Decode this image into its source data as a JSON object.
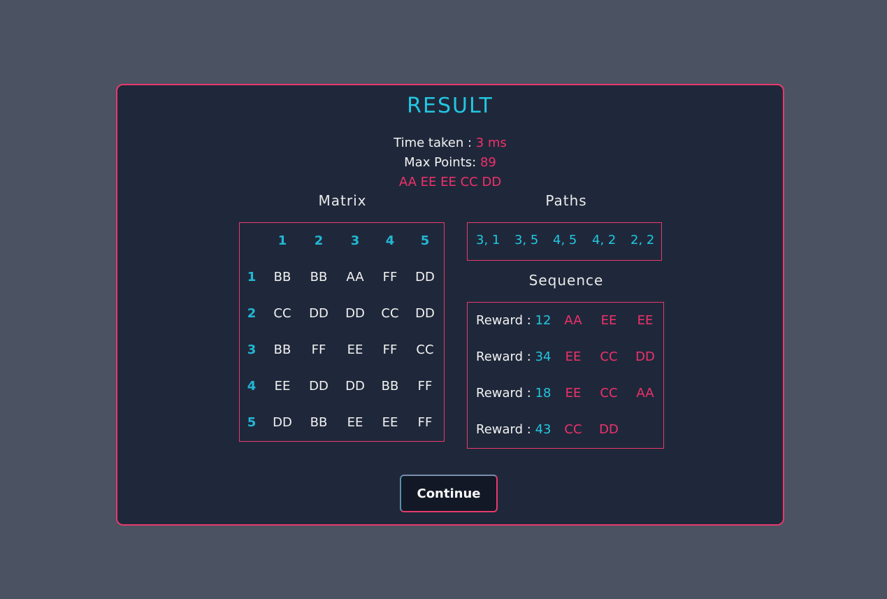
{
  "title": "RESULT",
  "time_taken_label": "Time taken :",
  "time_taken_value": "3 ms",
  "max_points_label": "Max Points:",
  "max_points_value": "89",
  "best_sequence": "AA EE EE CC DD",
  "matrix_heading": "Matrix",
  "paths_heading": "Paths",
  "sequence_heading": "Sequence",
  "matrix": {
    "col_headers": [
      "1",
      "2",
      "3",
      "4",
      "5"
    ],
    "row_headers": [
      "1",
      "2",
      "3",
      "4",
      "5"
    ],
    "rows": [
      [
        "BB",
        "BB",
        "AA",
        "FF",
        "DD"
      ],
      [
        "CC",
        "DD",
        "DD",
        "CC",
        "DD"
      ],
      [
        "BB",
        "FF",
        "EE",
        "FF",
        "CC"
      ],
      [
        "EE",
        "DD",
        "DD",
        "BB",
        "FF"
      ],
      [
        "DD",
        "BB",
        "EE",
        "EE",
        "FF"
      ]
    ]
  },
  "paths": [
    "3, 1",
    "3, 5",
    "4, 5",
    "4, 2",
    "2, 2"
  ],
  "sequences": [
    {
      "label": "Reward :",
      "reward": "12",
      "tokens": [
        "AA",
        "EE",
        "EE"
      ]
    },
    {
      "label": "Reward :",
      "reward": "34",
      "tokens": [
        "EE",
        "CC",
        "DD"
      ]
    },
    {
      "label": "Reward :",
      "reward": "18",
      "tokens": [
        "EE",
        "CC",
        "AA"
      ]
    },
    {
      "label": "Reward :",
      "reward": "43",
      "tokens": [
        "CC",
        "DD"
      ]
    }
  ],
  "continue_label": "Continue",
  "colors": {
    "accent_pink": "#f0306a",
    "accent_cyan": "#22c7e1",
    "panel": "#1f283a",
    "backdrop": "#4b5262"
  }
}
